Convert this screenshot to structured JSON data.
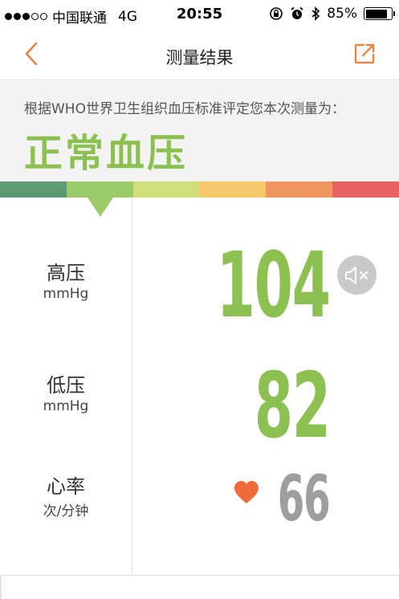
{
  "status_bar": {
    "carrier": "中国联通",
    "network": "4G",
    "time": "20:55",
    "battery": "85%",
    "battery_level": 0.85
  },
  "nav": {
    "title": "测量结果"
  },
  "result": {
    "caption": "根据WHO世界卫生组织血压标准评定您本次测量为：",
    "classification": "正常血压"
  },
  "scale": {
    "colors": [
      "#5e9a73",
      "#9acb6a",
      "#cfe07a",
      "#f5c86a",
      "#ef955e",
      "#e8605f"
    ],
    "selected_index": 1
  },
  "metrics": {
    "systolic": {
      "label": "高压",
      "unit": "mmHg",
      "value": "104"
    },
    "diastolic": {
      "label": "低压",
      "unit": "mmHg",
      "value": "82"
    },
    "heart_rate": {
      "label": "心率",
      "unit": "次/分钟",
      "value": "66"
    }
  },
  "icons": {
    "back": "chevron-left-icon",
    "share": "share-icon",
    "mute": "speaker-mute-icon",
    "heart": "heart-icon"
  },
  "colors": {
    "accent": "#f07a3a",
    "normal_green": "#8cc152",
    "heart": "#f06b3a",
    "heart_rate_value": "#9e9e9e"
  }
}
